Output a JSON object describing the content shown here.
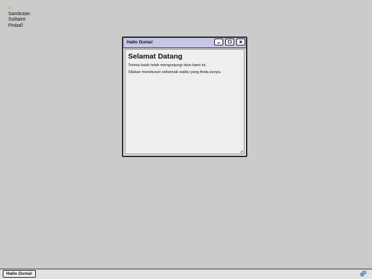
{
  "desktop": {
    "menu_marker": "3",
    "menu_items": [
      "Sambutan",
      "Solitaire",
      "Pinball"
    ]
  },
  "window": {
    "title": "Hallo Dunia!",
    "heading": "Selamat Datang",
    "paragraphs": [
      "Terima kasih telah mengunjungi situs kami ini.",
      "Silakan menelusuri sebanyak waktu yang Anda punya."
    ],
    "buttons": {
      "minimize_icon": "minimize-icon",
      "maximize_icon": "maximize-icon",
      "close_icon": "close-icon"
    }
  },
  "taskbar": {
    "task_label": "Hallo Dunia!",
    "tray_icon": "network-icon"
  },
  "colors": {
    "desktop": "#cbcbcb",
    "titlebar": "#c7c6e4",
    "window_bg": "#efefef",
    "menu_marker": "#f08a24"
  }
}
